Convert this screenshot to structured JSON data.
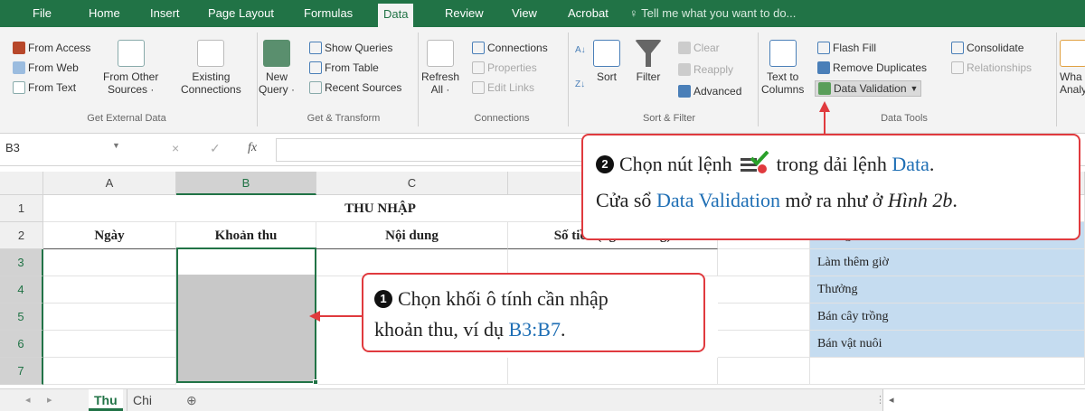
{
  "tabs": [
    "File",
    "Home",
    "Insert",
    "Page Layout",
    "Formulas",
    "Data",
    "Review",
    "View",
    "Acrobat"
  ],
  "active_tab": "Data",
  "tell_me": "Tell me what you want to do...",
  "ribbon": {
    "get_external": {
      "from_access": "From Access",
      "from_web": "From Web",
      "from_text": "From Text",
      "from_other_1": "From Other",
      "from_other_2": "Sources ·",
      "existing_1": "Existing",
      "existing_2": "Connections",
      "label": "Get External Data"
    },
    "get_transform": {
      "new_query_1": "New",
      "new_query_2": "Query ·",
      "show_queries": "Show Queries",
      "from_table": "From Table",
      "recent_sources": "Recent Sources",
      "label": "Get & Transform"
    },
    "connections": {
      "refresh_1": "Refresh",
      "refresh_2": "All ·",
      "connections": "Connections",
      "properties": "Properties",
      "edit_links": "Edit Links",
      "label": "Connections"
    },
    "sort_filter": {
      "sort": "Sort",
      "filter": "Filter",
      "clear": "Clear",
      "reapply": "Reapply",
      "advanced": "Advanced",
      "label": "Sort & Filter"
    },
    "data_tools": {
      "text_to_1": "Text to",
      "text_to_2": "Columns",
      "flash_fill": "Flash Fill",
      "remove_duplicates": "Remove Duplicates",
      "data_validation": "Data Validation",
      "consolidate": "Consolidate",
      "relationships": "Relationships",
      "label": "Data Tools"
    },
    "what_if_1": "Wha",
    "what_if_2": "Analy"
  },
  "formula_bar": {
    "name_box": "B3",
    "cancel": "×",
    "enter": "✓",
    "fx": "fx"
  },
  "grid": {
    "columns": [
      "A",
      "B",
      "C"
    ],
    "rows": [
      "1",
      "2",
      "3",
      "4",
      "5",
      "6",
      "7"
    ],
    "title": "THU NHẬP",
    "headers": [
      "Ngày",
      "Khoản thu",
      "Nội dung",
      "Số tiền (nghìn đồng)"
    ],
    "list": [
      "Lương",
      "Làm thêm giờ",
      "Thưởng",
      "Bán cây trồng",
      "Bán vật nuôi"
    ]
  },
  "sheets": [
    "Thu",
    "Chi"
  ],
  "active_sheet": "Thu",
  "callout1": {
    "number": "1",
    "line1": "Chọn khối ô tính cần nhập",
    "line2_a": "khoản thu, ví dụ ",
    "line2_b": "B3:B7",
    "line2_c": "."
  },
  "callout2": {
    "number": "2",
    "line1_a": "Chọn nút lệnh",
    "line1_b": "trong dải lệnh",
    "line1_c": "Data",
    "line1_d": ".",
    "line2_a": "Cửa sổ",
    "line2_b": "Data Validation",
    "line2_c": "mở ra như ở",
    "line2_d": "Hình 2b",
    "line2_e": "."
  },
  "colors": {
    "excel_green": "#217346",
    "callout_red": "#e03a3e",
    "link_blue": "#1f6fb5",
    "list_fill": "#c5dcf0"
  }
}
